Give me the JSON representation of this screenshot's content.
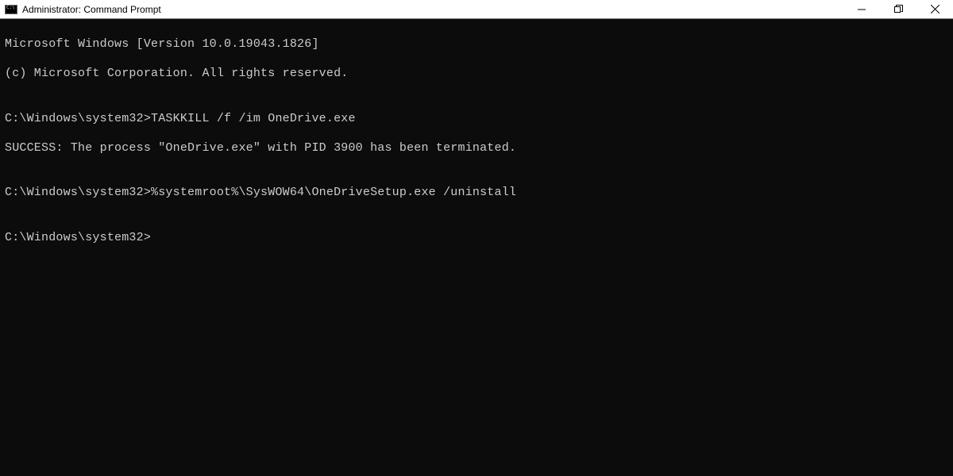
{
  "window": {
    "title": "Administrator: Command Prompt"
  },
  "terminal": {
    "line1": "Microsoft Windows [Version 10.0.19043.1826]",
    "line2": "(c) Microsoft Corporation. All rights reserved.",
    "blank1": "",
    "prompt1": "C:\\Windows\\system32>",
    "cmd1": "TASKKILL /f /im OneDrive.exe",
    "output1": "SUCCESS: The process \"OneDrive.exe\" with PID 3900 has been terminated.",
    "blank2": "",
    "prompt2": "C:\\Windows\\system32>",
    "cmd2": "%systemroot%\\SysWOW64\\OneDriveSetup.exe /uninstall",
    "blank3": "",
    "prompt3": "C:\\Windows\\system32>"
  }
}
